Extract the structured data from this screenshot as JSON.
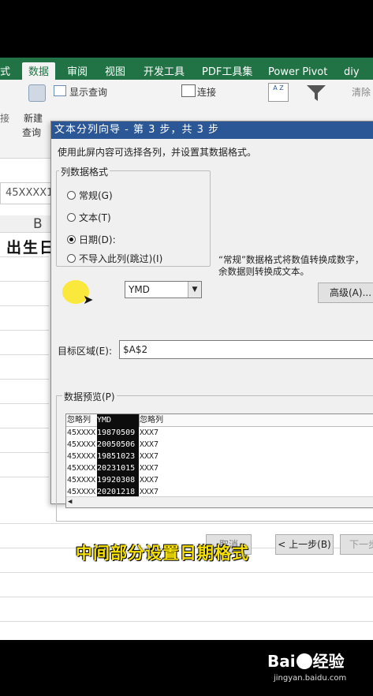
{
  "ribbon": {
    "tabs": [
      "式",
      "数据",
      "审阅",
      "视图",
      "开发工具",
      "PDF工具集",
      "Power Pivot",
      "diy"
    ],
    "active_tab": "数据",
    "show_query": "显示查询",
    "connections": "连接",
    "clear": "清除",
    "new_query_1": "新建",
    "new_query_2": "查询",
    "left_cut": "接"
  },
  "sheet": {
    "name_box": "45XXXX1",
    "column_b": "B",
    "cell_b2": "出生日"
  },
  "dialog": {
    "title": "文本分列向导 - 第 3 步，共 3 步",
    "description": "使用此屏内容可选择各列，并设置其数据格式。",
    "format_group_label": "列数据格式",
    "options": [
      {
        "label": "常规(G)",
        "checked": false
      },
      {
        "label": "文本(T)",
        "checked": false
      },
      {
        "label": "日期(D):",
        "checked": true
      },
      {
        "label": "不导入此列(跳过)(I)",
        "checked": false
      }
    ],
    "date_format": "YMD",
    "note_line1": "“常规”数据格式将数值转换成数字，",
    "note_line2": "余数据则转换成文本。",
    "advanced_button": "高级(A)...",
    "destination_label": "目标区域(E):",
    "destination_value": "$A$2",
    "preview_label": "数据预览(P)",
    "preview_headers": [
      "忽略列",
      "YMD",
      "忽略列"
    ],
    "preview_rows": [
      [
        "45XXXX",
        "19870509",
        "XXX7"
      ],
      [
        "45XXXX",
        "20050506",
        "XXX7"
      ],
      [
        "45XXXX",
        "19851023",
        "XXX7"
      ],
      [
        "45XXXX",
        "20231015",
        "XXX7"
      ],
      [
        "45XXXX",
        "19920308",
        "XXX7"
      ],
      [
        "45XXXX",
        "20201218",
        "XXX7"
      ]
    ],
    "cancel_button": "取消",
    "back_button": "< 上一步(B)",
    "next_button": "下一步"
  },
  "caption": "中间部分设置日期格式",
  "watermark": {
    "brand_a": "Bai",
    "brand_b": "经验",
    "url": "jingyan.baidu.com"
  }
}
